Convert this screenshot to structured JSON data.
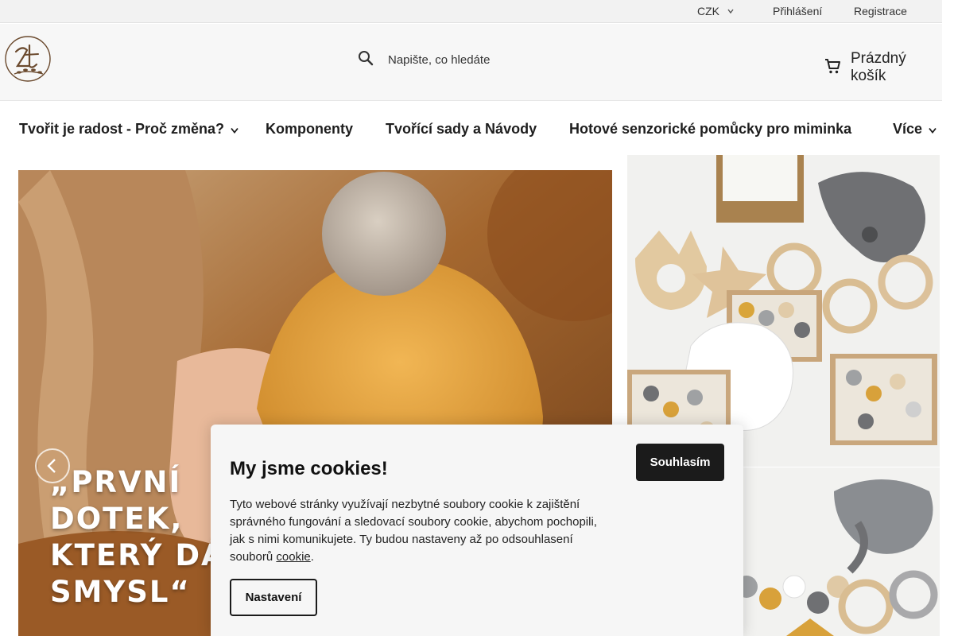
{
  "topbar": {
    "currency": "CZK",
    "login": "Přihlášení",
    "register": "Registrace"
  },
  "header": {
    "search_placeholder": "Napište, co hledáte",
    "cart_label": "Prázdný košík"
  },
  "nav": {
    "items": [
      {
        "label": "Tvořit je radost - Proč změna?",
        "has_dropdown": true
      },
      {
        "label": "Komponenty",
        "has_dropdown": false
      },
      {
        "label": "Tvořící sady a Návody",
        "has_dropdown": false
      },
      {
        "label": "Hotové senzorické pomůcky pro miminka",
        "has_dropdown": false
      },
      {
        "label": "Více",
        "has_dropdown": true
      }
    ]
  },
  "hero": {
    "quote_lines": [
      "„PRVNÍ",
      "DOTEK,",
      "KTERÝ DÁVÁ",
      "SMYSL“"
    ]
  },
  "cookie": {
    "title": "My jsme cookies!",
    "text": "Tyto webové stránky využívají nezbytné soubory cookie k zajištění správného fungování a sledovací soubory cookie, abychom pochopili, jak s nimi komunikujete. Ty budou nastaveny až po odsouhlasení souborů",
    "link": "cookie",
    "text_end": ".",
    "agree_label": "Souhlasím",
    "settings_label": "Nastavení"
  },
  "icons": {
    "search": "search-icon",
    "cart": "cart-icon",
    "currency_caret": "chevron-down-icon",
    "nav_caret": "chevron-down-icon",
    "hero_prev": "chevron-left-icon"
  }
}
